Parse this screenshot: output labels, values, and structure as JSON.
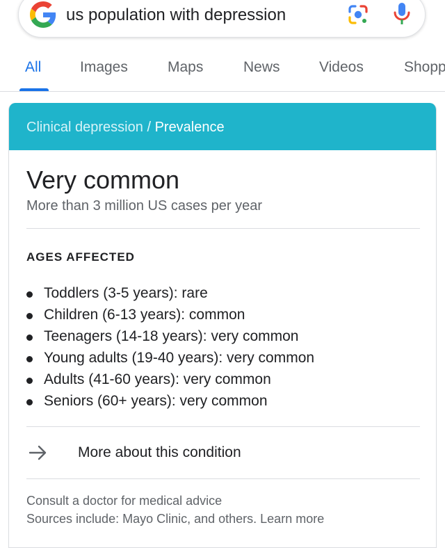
{
  "search": {
    "query": "us population with depression",
    "logo_icon": "google-g-icon",
    "lens_icon": "google-lens-icon",
    "mic_icon": "microphone-icon"
  },
  "tabs": [
    {
      "label": "All",
      "active": true
    },
    {
      "label": "Images",
      "active": false
    },
    {
      "label": "Maps",
      "active": false
    },
    {
      "label": "News",
      "active": false
    },
    {
      "label": "Videos",
      "active": false
    },
    {
      "label": "Shopp",
      "active": false
    }
  ],
  "card": {
    "breadcrumb": {
      "parent": "Clinical depression",
      "separator": "/",
      "current": "Prevalence"
    },
    "headline": "Very common",
    "subline": "More than 3 million US cases per year",
    "ages_title": "AGES AFFECTED",
    "ages": [
      "Toddlers (3-5 years): rare",
      "Children (6-13 years): common",
      "Teenagers (14-18 years): very common",
      "Young adults (19-40 years): very common",
      "Adults (41-60 years): very common",
      "Seniors (60+ years): very common"
    ],
    "more_link": {
      "icon": "arrow-right-icon",
      "label": "More about this condition"
    },
    "footer": {
      "advice": "Consult a doctor for medical advice",
      "sources": "Sources include: Mayo Clinic, and others. Learn more"
    }
  },
  "colors": {
    "accent": "#1a73e8",
    "card_header": "#1fb4cb",
    "text_primary": "#202124",
    "text_secondary": "#5f6368"
  }
}
